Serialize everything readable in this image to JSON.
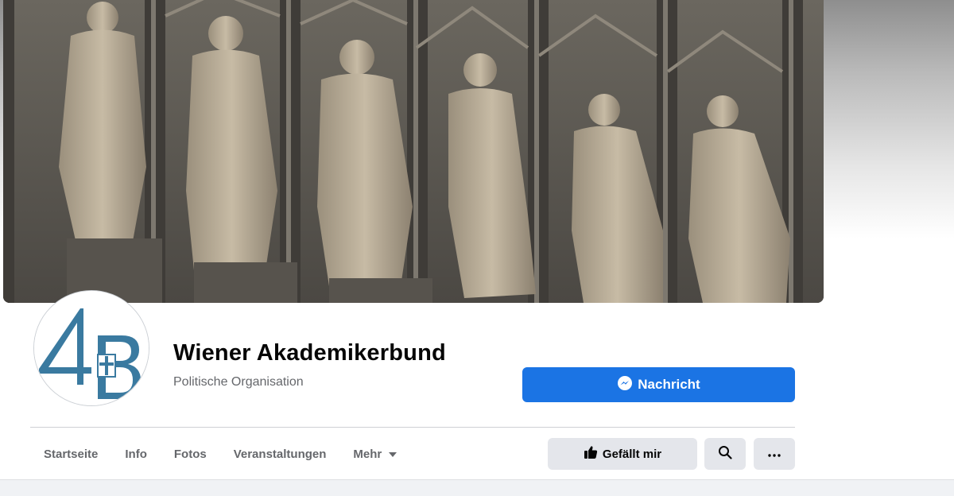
{
  "page": {
    "name": "Wiener Akademikerbund",
    "category": "Politische Organisation"
  },
  "cover": {
    "icon": "cover-photo"
  },
  "avatar": {
    "icon": "organization-logo",
    "brand_color": "#3a7aa0"
  },
  "actions": {
    "message_label": "Nachricht",
    "message_icon": "messenger-icon",
    "like_label": "Gefällt mir",
    "like_icon": "thumbs-up-icon",
    "search_icon": "search-icon",
    "more_icon": "more-dots-icon"
  },
  "tabs": [
    {
      "label": "Startseite"
    },
    {
      "label": "Info"
    },
    {
      "label": "Fotos"
    },
    {
      "label": "Veranstaltungen"
    },
    {
      "label": "Mehr"
    }
  ],
  "colors": {
    "primary_button": "#1b74e4",
    "secondary_button": "#e4e6eb",
    "muted_text": "#65676b"
  }
}
